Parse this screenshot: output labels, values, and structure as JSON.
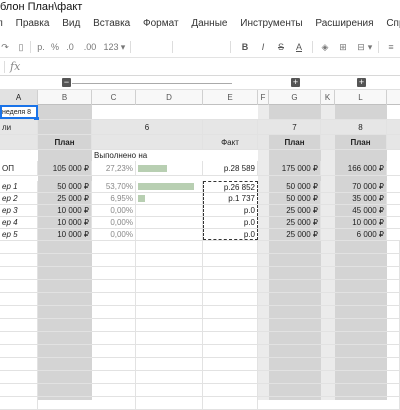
{
  "doc": {
    "title": "блон План\\факт"
  },
  "menu": [
    "л",
    "Правка",
    "Вид",
    "Вставка",
    "Формат",
    "Данные",
    "Инструменты",
    "Расширения",
    "Справка"
  ],
  "toolbar": {
    "currency": "р.",
    "percent": "%",
    "dec_less": ".0",
    "dec_more": ".00",
    "num_format": "123",
    "bold": "B",
    "italic": "I",
    "strike": "S",
    "text_color": "A"
  },
  "formula": {
    "fx": "fx",
    "value": ""
  },
  "group": {
    "collapse": "−",
    "expand1": "+",
    "expand2": "+"
  },
  "columns": [
    "A",
    "B",
    "C",
    "D",
    "E",
    "F",
    "G",
    "K",
    "L"
  ],
  "week_label": "неделя 8",
  "header1": {
    "a": "ли",
    "week6": "6",
    "week7": "7",
    "week8": "8"
  },
  "header2": {
    "b": "План",
    "e": "Факт",
    "g": "План",
    "l": "План"
  },
  "summary": {
    "a": "ОП",
    "b": "105 000 ₽",
    "c": "27,23%",
    "c_value": 0.2723,
    "e": "р.28 589",
    "g": "175 000 ₽",
    "l": "166 000 ₽",
    "c_label": "Выполнено на"
  },
  "managers": [
    {
      "a": "ер 1",
      "b": "50 000 ₽",
      "c": "53,70%",
      "c_value": 0.537,
      "e": "р.26 852",
      "g": "50 000 ₽",
      "l": "70 000 ₽"
    },
    {
      "a": "ер 2",
      "b": "25 000 ₽",
      "c": "6,95%",
      "c_value": 0.0695,
      "e": "р.1 737",
      "g": "50 000 ₽",
      "l": "35 000 ₽"
    },
    {
      "a": "ер 3",
      "b": "10 000 ₽",
      "c": "0,00%",
      "c_value": 0,
      "e": "р.0",
      "g": "25 000 ₽",
      "l": "45 000 ₽"
    },
    {
      "a": "ер 4",
      "b": "10 000 ₽",
      "c": "0,00%",
      "c_value": 0,
      "e": "р.0",
      "g": "25 000 ₽",
      "l": "10 000 ₽"
    },
    {
      "a": "ер 5",
      "b": "10 000 ₽",
      "c": "0,00%",
      "c_value": 0,
      "e": "р.0",
      "g": "25 000 ₽",
      "l": "6 000 ₽"
    }
  ]
}
